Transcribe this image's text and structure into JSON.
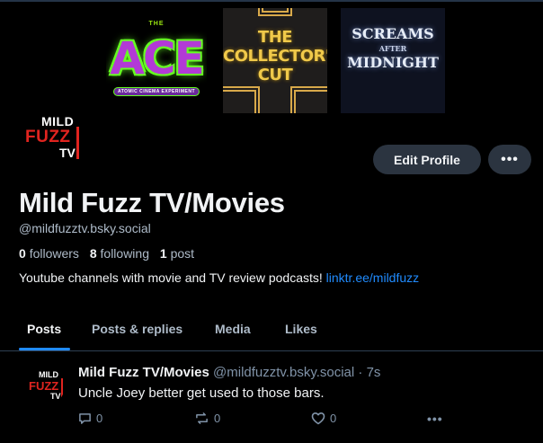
{
  "banner": {
    "ace": {
      "top_text": "THE",
      "main_text": "ACE",
      "sub_text": "ATOMIC CINEMA EXPERIMENT"
    },
    "collectors_cut": {
      "lines": [
        "THE",
        "COLLECTOR'S",
        "CUT"
      ]
    },
    "screams": {
      "line1": "SCREAMS",
      "line2": "AFTER",
      "line3": "MIDNIGHT"
    }
  },
  "avatar": {
    "mild": "MILD",
    "fuzz": "FUZZ",
    "tv": "TV"
  },
  "profile": {
    "edit_label": "Edit Profile",
    "more_label": "•••",
    "display_name": "Mild Fuzz TV/Movies",
    "handle": "@mildfuzztv.bsky.social",
    "followers_count": "0",
    "followers_label": "followers",
    "following_count": "8",
    "following_label": "following",
    "posts_count": "1",
    "posts_label": "post",
    "bio_text": "Youtube channels with movie and TV review podcasts!",
    "bio_link": "linktr.ee/mildfuzz"
  },
  "tabs": [
    {
      "label": "Posts",
      "active": true
    },
    {
      "label": "Posts & replies"
    },
    {
      "label": "Media"
    },
    {
      "label": "Likes"
    }
  ],
  "post": {
    "author_name": "Mild Fuzz TV/Movies",
    "author_handle": "@mildfuzztv.bsky.social",
    "separator": "·",
    "time": "7s",
    "text": "Uncle Joey better get used to those bars.",
    "reply_count": "0",
    "repost_count": "0",
    "like_count": "0",
    "more_label": "•••"
  },
  "colors": {
    "background": "#000000",
    "accent": "#208bfe",
    "button_bg": "#2b3440",
    "brand_red": "#e0241f"
  }
}
